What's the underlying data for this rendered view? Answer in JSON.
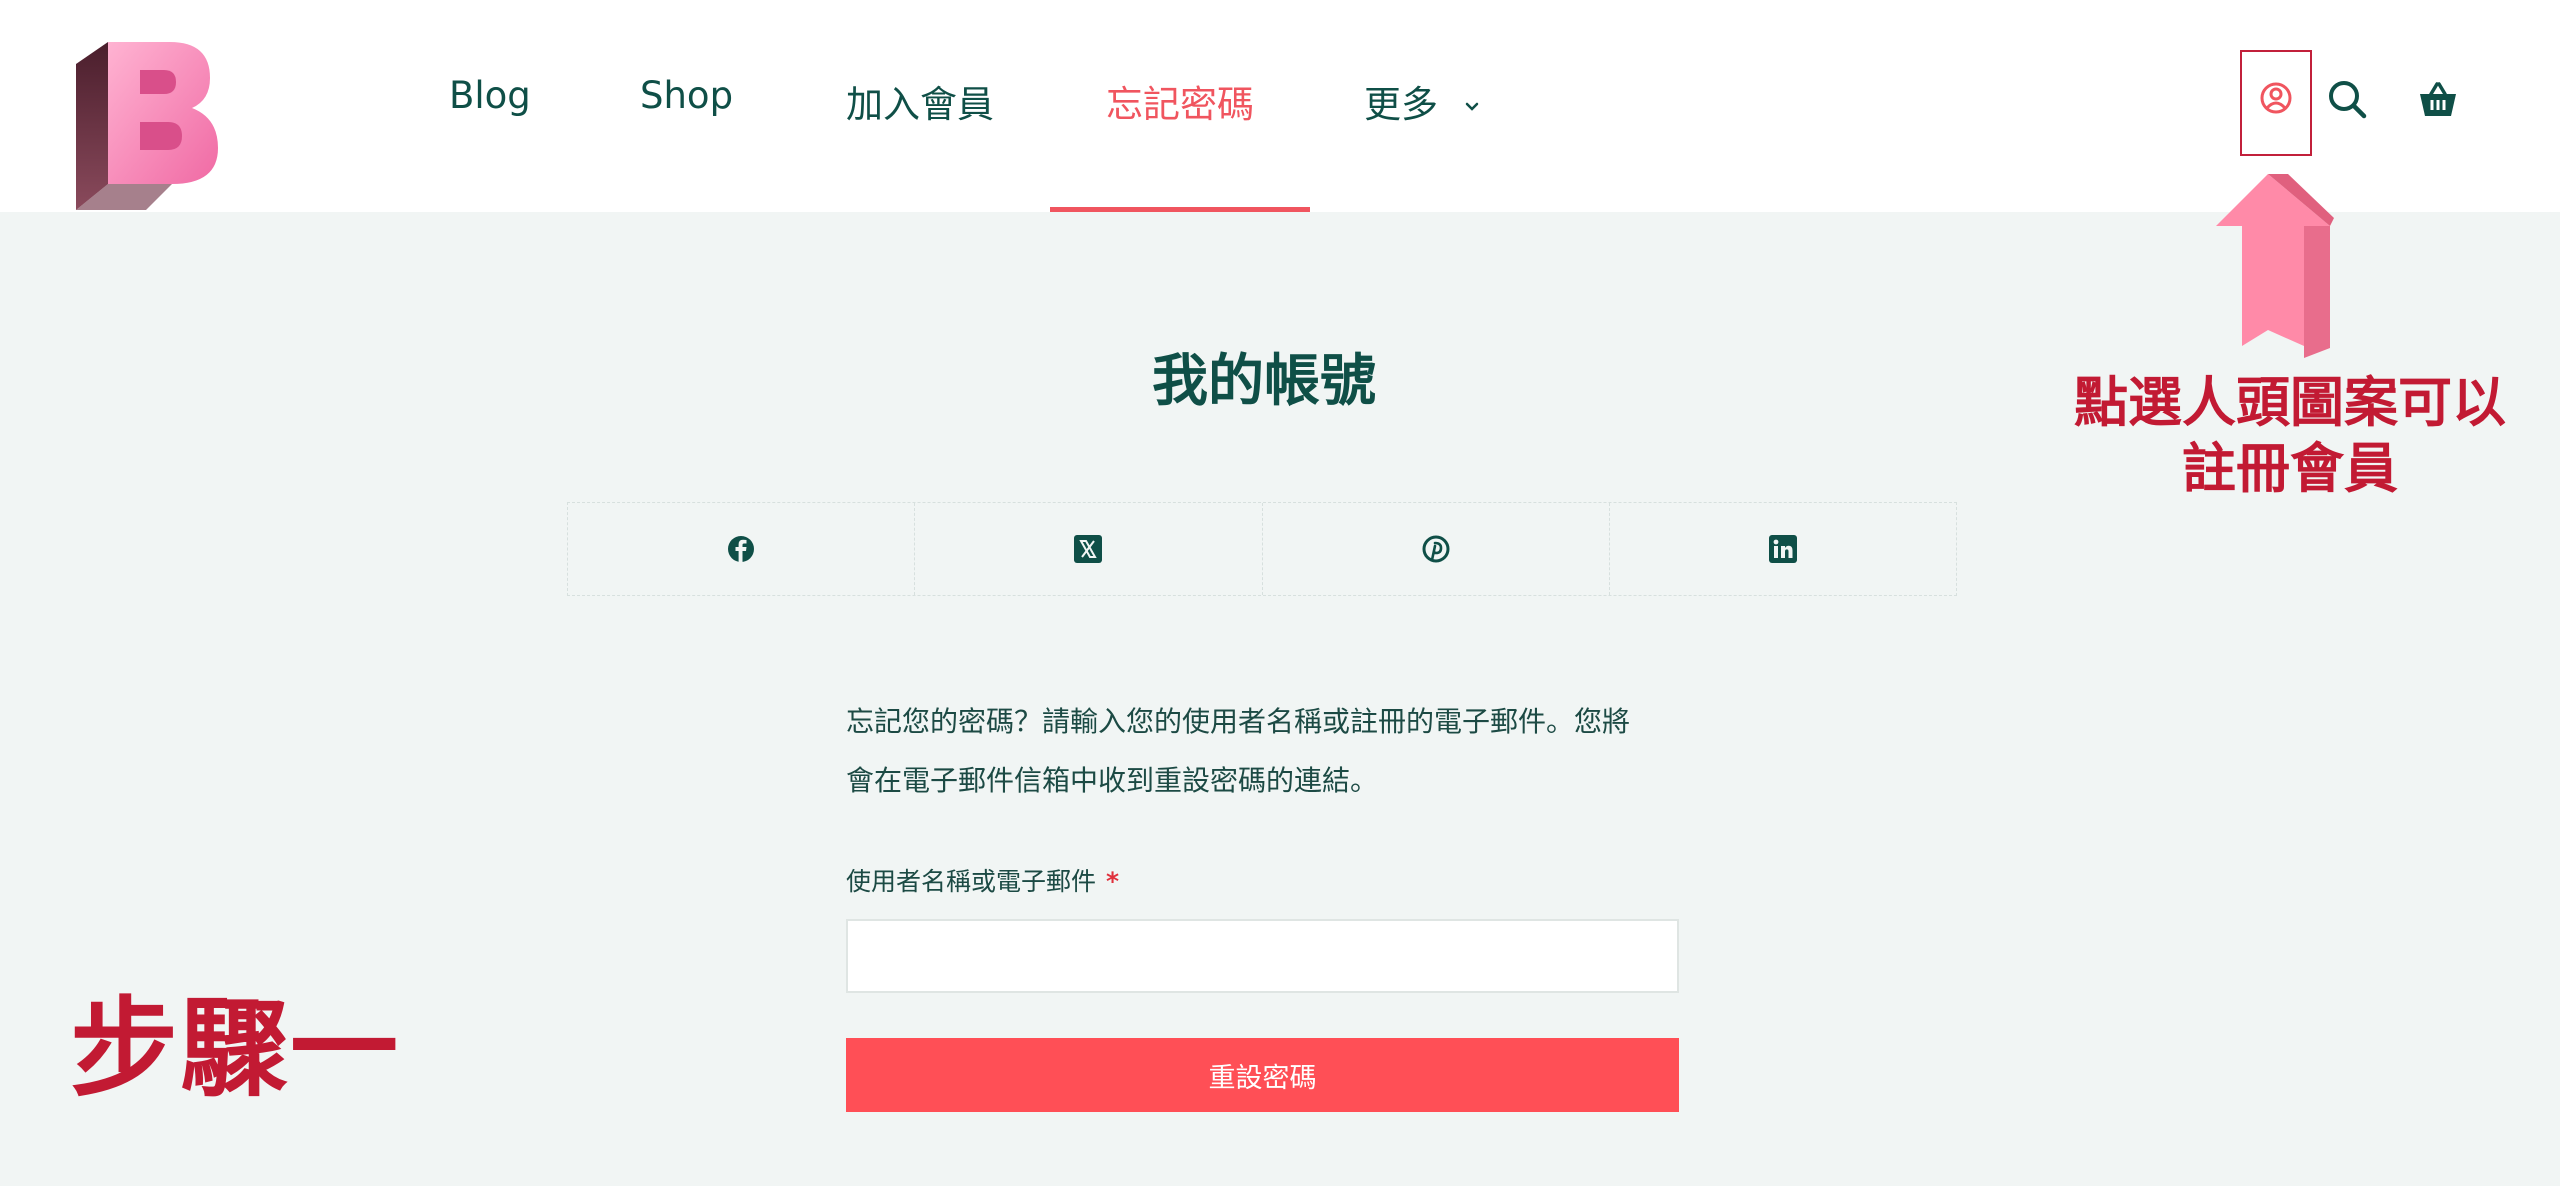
{
  "nav": {
    "items": [
      {
        "label": "Blog"
      },
      {
        "label": "Shop"
      },
      {
        "label": "加入會員"
      },
      {
        "label": "忘記密碼"
      },
      {
        "label": "更多"
      }
    ],
    "active_index": 3
  },
  "header_icons": [
    "account-icon",
    "search-icon",
    "cart-icon"
  ],
  "page": {
    "title": "我的帳號",
    "share_icons": [
      "facebook-icon",
      "x-icon",
      "pinterest-icon",
      "linkedin-icon"
    ],
    "description_line1": "忘記您的密碼？請輸入您的使用者名稱或註冊的電子郵件。您將",
    "description_line2": "會在電子郵件信箱中收到重設密碼的連結。",
    "field_label": "使用者名稱或電子郵件",
    "required_mark": "*",
    "field_value": "",
    "submit_label": "重設密碼"
  },
  "annotation": {
    "line1": "點選人頭圖案可以",
    "line2": "註冊會員",
    "step": "步驟一"
  },
  "colors": {
    "brand_green": "#0f4f47",
    "accent_red": "#f0555f",
    "button_red": "#ff4f56",
    "annotation_red": "#c21a33",
    "arrow_pink": "#ff8aa8",
    "content_bg": "#f1f5f4"
  }
}
